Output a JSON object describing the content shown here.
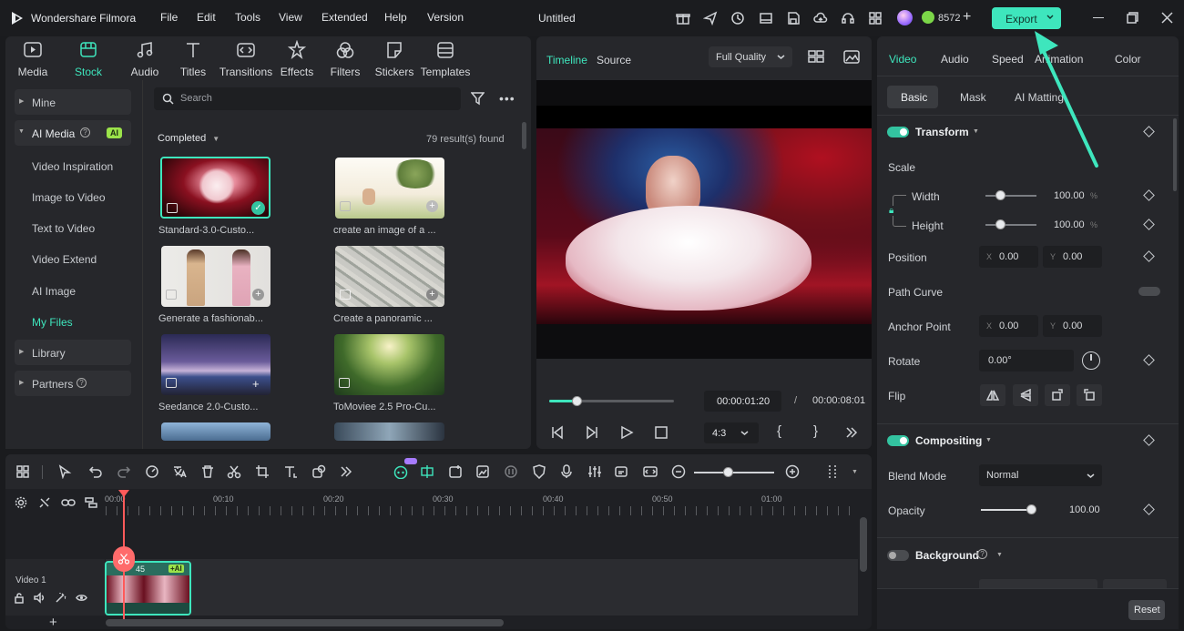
{
  "app": {
    "title": "Wondershare Filmora",
    "project_title": "Untitled",
    "credits": "8572"
  },
  "menu": [
    "File",
    "Edit",
    "Tools",
    "View",
    "Extended",
    "Help",
    "Version"
  ],
  "export_label": "Export",
  "toolbar_tabs": [
    {
      "label": "Media",
      "icon": "media-icon"
    },
    {
      "label": "Stock Media",
      "icon": "stock-media-icon",
      "active": true
    },
    {
      "label": "Audio",
      "icon": "audio-icon"
    },
    {
      "label": "Titles",
      "icon": "titles-icon"
    },
    {
      "label": "Transitions",
      "icon": "transitions-icon"
    },
    {
      "label": "Effects",
      "icon": "effects-icon"
    },
    {
      "label": "Filters",
      "icon": "filters-icon"
    },
    {
      "label": "Stickers",
      "icon": "stickers-icon"
    },
    {
      "label": "Templates",
      "icon": "templates-icon"
    }
  ],
  "sidebar": {
    "mine": "Mine",
    "ai_media": "AI Media",
    "ai_badge": "AI",
    "items": [
      "Video Inspiration",
      "Image to Video",
      "Text to Video",
      "Video Extend",
      "AI Image",
      "My Files"
    ],
    "active_item": "My Files",
    "library": "Library",
    "partners": "Partners"
  },
  "search": {
    "placeholder": "Search"
  },
  "filter": {
    "status": "Completed",
    "results": "79 result(s) found"
  },
  "media_items": [
    {
      "caption": "Standard-3.0-Custo..."
    },
    {
      "caption": "create an image of a ..."
    },
    {
      "caption": "Generate a fashionab..."
    },
    {
      "caption": "Create a panoramic ..."
    },
    {
      "caption": "Seedance 2.0-Custo..."
    },
    {
      "caption": "ToMoviee 2.5 Pro-Cu..."
    }
  ],
  "preview": {
    "tab_timeline": "Timeline",
    "tab_source": "Source",
    "quality": "Full Quality",
    "current_time": "00:00:01:20",
    "separator": "/",
    "total_time": "00:00:08:01",
    "aspect": "4:3",
    "progress": 0.22
  },
  "props": {
    "tabs": [
      "Video",
      "Audio",
      "Speed",
      "Animation",
      "Color"
    ],
    "subtabs": [
      "Basic",
      "Mask",
      "AI Matting"
    ],
    "transform": "Transform",
    "scale": "Scale",
    "width": "Width",
    "width_val": "100.00",
    "height": "Height",
    "height_val": "100.00",
    "pct": "%",
    "position": "Position",
    "pos_x": "0.00",
    "pos_y": "0.00",
    "x": "X",
    "y": "Y",
    "path_curve": "Path Curve",
    "anchor": "Anchor Point",
    "anchor_x": "0.00",
    "anchor_y": "0.00",
    "rotate": "Rotate",
    "rotate_val": "0.00°",
    "flip": "Flip",
    "compositing": "Compositing",
    "blend_mode": "Blend Mode",
    "blend_val": "Normal",
    "opacity": "Opacity",
    "opacity_val": "100.00",
    "background": "Background",
    "reset": "Reset"
  },
  "timeline": {
    "ticks": [
      "00:00",
      "00:10",
      "00:20",
      "00:30",
      "00:40",
      "00:50",
      "01:00"
    ],
    "track_label": "Video 1",
    "clip_time": "45",
    "clip_badge": "AI"
  },
  "colors": {
    "accent": "#33c3a0",
    "export": "#3ee6bd",
    "playhead": "#ff5a5a"
  }
}
